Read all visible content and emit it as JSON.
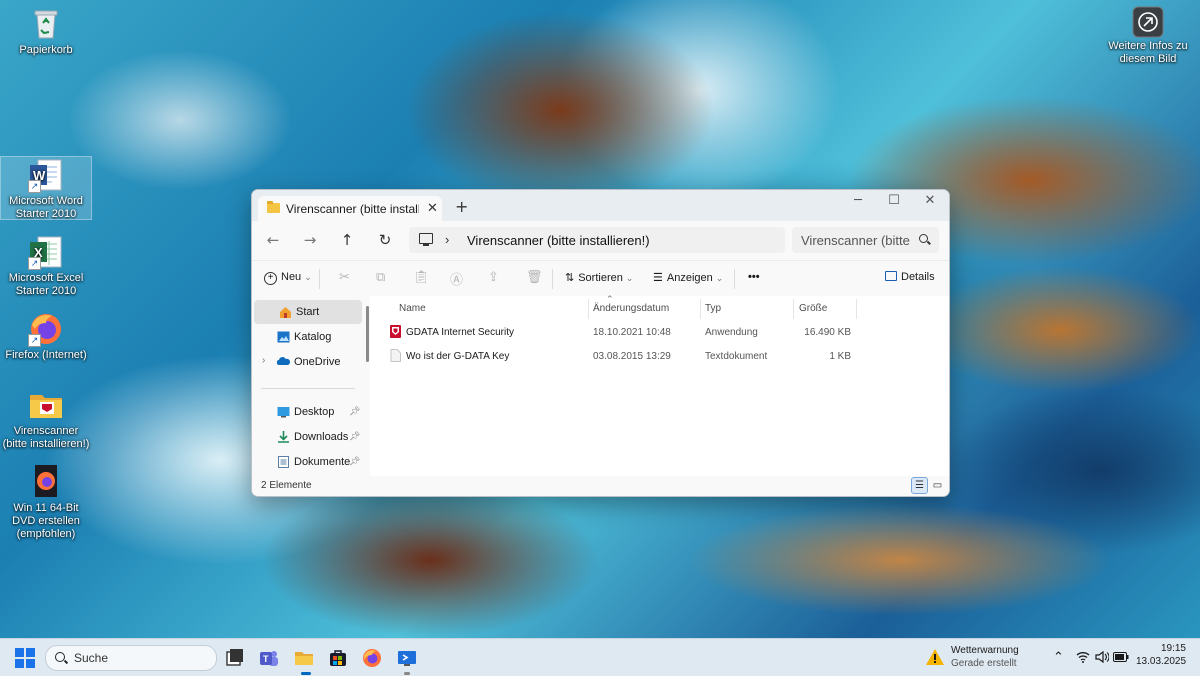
{
  "desktop": {
    "icons": [
      {
        "label": "Papierkorb",
        "icon": "recycle-bin-icon"
      },
      {
        "label": "Microsoft Word Starter 2010",
        "icon": "word-icon"
      },
      {
        "label": "Microsoft Excel Starter 2010",
        "icon": "excel-icon"
      },
      {
        "label": "Firefox (Internet)",
        "icon": "firefox-icon"
      },
      {
        "label": "Virenscanner (bitte installieren!)",
        "icon": "folder-icon"
      },
      {
        "label": "Win 11 64-Bit DVD erstellen (empfohlen)",
        "icon": "firefox-file-icon"
      }
    ],
    "info_widget": {
      "label": "Weitere Infos zu diesem Bild",
      "icon": "camera-icon"
    }
  },
  "explorer": {
    "tab_title": "Virenscanner (bitte installieren!)",
    "address_path": "Virenscanner (bitte installieren!)",
    "search_placeholder": "Virenscanner (bitte ins",
    "commands": {
      "new": "Neu",
      "sort": "Sortieren",
      "view": "Anzeigen",
      "more": "•••",
      "details": "Details"
    },
    "sidebar": [
      {
        "label": "Start",
        "icon": "home-icon",
        "selected": true
      },
      {
        "label": "Katalog",
        "icon": "gallery-icon"
      },
      {
        "label": "OneDrive",
        "icon": "onedrive-icon"
      },
      {
        "label": "Desktop",
        "icon": "desktop-icon",
        "pinned": true
      },
      {
        "label": "Downloads",
        "icon": "download-icon",
        "pinned": true
      },
      {
        "label": "Dokumente",
        "icon": "documents-icon",
        "pinned": true
      }
    ],
    "columns": {
      "name": "Name",
      "modified": "Änderungsdatum",
      "type": "Typ",
      "size": "Größe"
    },
    "files": [
      {
        "name": "GDATA Internet Security",
        "modified": "18.10.2021 10:48",
        "type": "Anwendung",
        "size": "16.490 KB",
        "icon": "gdata-app-icon"
      },
      {
        "name": "Wo ist der G-DATA Key",
        "modified": "03.08.2015 13:29",
        "type": "Textdokument",
        "size": "1 KB",
        "icon": "text-file-icon"
      }
    ],
    "status": "2 Elemente"
  },
  "taskbar": {
    "search_label": "Suche",
    "weather_title": "Wetterwarnung",
    "weather_sub": "Gerade erstellt",
    "time": "19:15",
    "date": "13.03.2025"
  },
  "colors": {
    "accent": "#0067c0",
    "gdata_red": "#c8102e",
    "folder_yellow": "#f4c542"
  }
}
